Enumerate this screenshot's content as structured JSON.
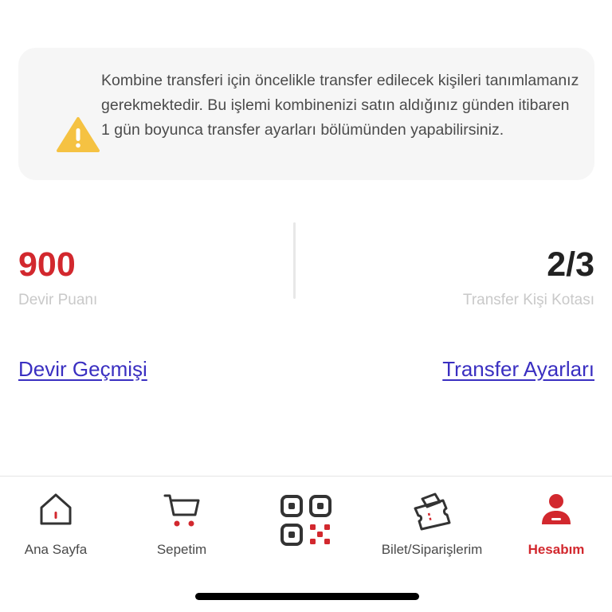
{
  "notice": {
    "icon": "warning-triangle-icon",
    "text": "Kombine transferi için öncelikle transfer edilecek kişileri tanımlamanız gerekmektedir. Bu işlemi kombinenizi satın aldığınız günden itibaren 1 gün boyunca transfer ayarları bölümünden yapabilirsiniz."
  },
  "stats": {
    "devir_puani": {
      "value": "900",
      "label": "Devir Puanı"
    },
    "kota": {
      "value": "2/3",
      "label": "Transfer Kişi Kotası"
    }
  },
  "links": {
    "devir_gecmisi": "Devir Geçmişi",
    "transfer_ayarlari": "Transfer Ayarları"
  },
  "tabbar": {
    "tabs": [
      {
        "label": "Ana Sayfa",
        "icon": "home-icon"
      },
      {
        "label": "Sepetim",
        "icon": "cart-icon"
      },
      {
        "label": "",
        "icon": "qr-code-icon"
      },
      {
        "label": "Bilet/Siparişlerim",
        "icon": "tickets-icon"
      },
      {
        "label": "Hesabım",
        "icon": "account-icon",
        "active": true
      }
    ]
  },
  "colors": {
    "accent_red": "#d2282e",
    "link_blue": "#3a2fc1",
    "warning_yellow": "#f5c242"
  }
}
